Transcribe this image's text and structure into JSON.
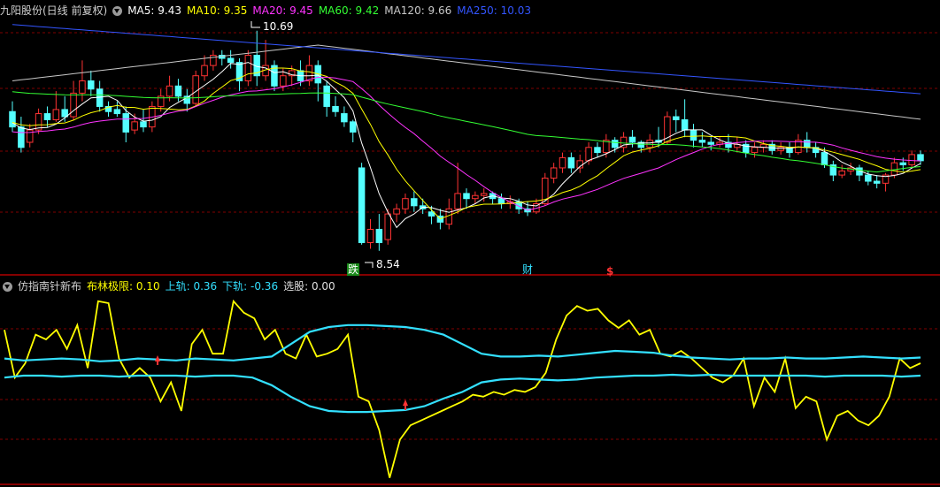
{
  "main_legend": {
    "title": "九阳股份(日线 前复权)",
    "items": [
      {
        "label": "MA5: 9.43",
        "color": "#ffffff"
      },
      {
        "label": "MA10: 9.35",
        "color": "#ffff00"
      },
      {
        "label": "MA20: 9.45",
        "color": "#ff33ff"
      },
      {
        "label": "MA60: 9.42",
        "color": "#33ff33"
      },
      {
        "label": "MA120: 9.66",
        "color": "#c8c8c8"
      },
      {
        "label": "MA250: 10.03",
        "color": "#3355ff"
      }
    ]
  },
  "indicator_legend": {
    "title": "仿指南针新布",
    "items": [
      {
        "label": "布林极限: 0.10",
        "color": "#ffff00"
      },
      {
        "label": "上轨: 0.36",
        "color": "#33e0ff"
      },
      {
        "label": "下轨: -0.36",
        "color": "#33e0ff"
      },
      {
        "label": "选股: 0.00",
        "color": "#e0e0e0"
      }
    ]
  },
  "annotations": {
    "high_price": "10.69",
    "low_price": "8.54",
    "marker_die": "跌",
    "marker_cai": "财",
    "marker_dollar": "$"
  },
  "colors": {
    "up": "#ff3333",
    "down": "#54ffff",
    "grid": "#800000",
    "separator": "#b00000"
  },
  "chart_data": [
    {
      "type": "candlestick",
      "title": "九阳股份(日线 前复权)",
      "ylim": [
        8.4,
        10.8
      ],
      "candles": [
        [
          9.9,
          9.75,
          10.0,
          9.7
        ],
        [
          9.75,
          9.55,
          9.85,
          9.5
        ],
        [
          9.6,
          9.72,
          9.78,
          9.55
        ],
        [
          9.72,
          9.88,
          9.93,
          9.68
        ],
        [
          9.88,
          9.82,
          9.95,
          9.75
        ],
        [
          9.82,
          9.92,
          10.1,
          9.8
        ],
        [
          9.92,
          9.85,
          10.05,
          9.8
        ],
        [
          9.85,
          10.08,
          10.2,
          9.82
        ],
        [
          10.08,
          10.2,
          10.4,
          10.0
        ],
        [
          10.2,
          10.12,
          10.3,
          10.05
        ],
        [
          10.12,
          9.95,
          10.2,
          9.9
        ],
        [
          9.95,
          9.9,
          10.0,
          9.85
        ],
        [
          9.92,
          9.88,
          10.0,
          9.85
        ],
        [
          9.88,
          9.7,
          9.95,
          9.6
        ],
        [
          9.72,
          9.8,
          9.88,
          9.68
        ],
        [
          9.8,
          9.75,
          9.92,
          9.7
        ],
        [
          9.75,
          9.95,
          10.0,
          9.7
        ],
        [
          9.95,
          10.05,
          10.12,
          9.9
        ],
        [
          10.05,
          10.15,
          10.25,
          10.0
        ],
        [
          10.15,
          10.05,
          10.22,
          10.0
        ],
        [
          10.05,
          9.98,
          10.12,
          9.9
        ],
        [
          9.98,
          10.25,
          10.3,
          9.95
        ],
        [
          10.25,
          10.35,
          10.45,
          10.2
        ],
        [
          10.35,
          10.45,
          10.5,
          10.3
        ],
        [
          10.45,
          10.42,
          10.5,
          10.35
        ],
        [
          10.42,
          10.38,
          10.5,
          10.32
        ],
        [
          10.38,
          10.2,
          10.42,
          10.1
        ],
        [
          10.2,
          10.45,
          10.5,
          10.15
        ],
        [
          10.45,
          10.25,
          10.69,
          10.15
        ],
        [
          10.25,
          10.35,
          10.6,
          10.2
        ],
        [
          10.35,
          10.15,
          10.4,
          10.1
        ],
        [
          10.15,
          10.25,
          10.32,
          10.1
        ],
        [
          10.25,
          10.3,
          10.35,
          10.15
        ],
        [
          10.3,
          10.2,
          10.4,
          10.15
        ],
        [
          10.2,
          10.35,
          10.45,
          10.15
        ],
        [
          10.35,
          10.18,
          10.4,
          10.0
        ],
        [
          10.15,
          9.95,
          10.2,
          9.85
        ],
        [
          9.95,
          9.9,
          10.05,
          9.85
        ],
        [
          9.88,
          9.8,
          9.95,
          9.75
        ],
        [
          9.8,
          9.7,
          9.82,
          9.6
        ],
        [
          9.35,
          8.62,
          9.4,
          8.6
        ],
        [
          8.62,
          8.75,
          8.85,
          8.56
        ],
        [
          8.75,
          8.62,
          8.9,
          8.54
        ],
        [
          8.65,
          8.9,
          8.95,
          8.6
        ],
        [
          8.9,
          8.95,
          9.0,
          8.82
        ],
        [
          8.95,
          9.05,
          9.1,
          8.9
        ],
        [
          9.05,
          8.98,
          9.12,
          8.92
        ],
        [
          8.98,
          8.95,
          9.05,
          8.9
        ],
        [
          8.92,
          8.88,
          8.98,
          8.8
        ],
        [
          8.88,
          8.82,
          8.95,
          8.75
        ],
        [
          8.8,
          8.95,
          9.05,
          8.75
        ],
        [
          8.95,
          9.1,
          9.4,
          8.9
        ],
        [
          9.1,
          9.05,
          9.15,
          8.95
        ],
        [
          9.05,
          9.08,
          9.12,
          9.0
        ],
        [
          9.08,
          9.1,
          9.15,
          9.02
        ],
        [
          9.1,
          9.05,
          9.12,
          9.0
        ],
        [
          9.05,
          9.0,
          9.1,
          8.95
        ],
        [
          9.0,
          9.02,
          9.08,
          8.95
        ],
        [
          9.02,
          8.95,
          9.05,
          8.9
        ],
        [
          8.95,
          8.92,
          9.02,
          8.88
        ],
        [
          8.92,
          9.0,
          9.05,
          8.9
        ],
        [
          9.0,
          9.25,
          9.3,
          8.98
        ],
        [
          9.25,
          9.35,
          9.4,
          9.2
        ],
        [
          9.35,
          9.45,
          9.5,
          9.3
        ],
        [
          9.45,
          9.35,
          9.5,
          9.3
        ],
        [
          9.35,
          9.42,
          9.48,
          9.3
        ],
        [
          9.42,
          9.55,
          9.6,
          9.38
        ],
        [
          9.55,
          9.5,
          9.6,
          9.45
        ],
        [
          9.5,
          9.62,
          9.68,
          9.45
        ],
        [
          9.62,
          9.55,
          9.65,
          9.5
        ],
        [
          9.55,
          9.65,
          9.7,
          9.5
        ],
        [
          9.65,
          9.6,
          9.72,
          9.55
        ],
        [
          9.6,
          9.55,
          9.62,
          9.5
        ],
        [
          9.55,
          9.62,
          9.68,
          9.5
        ],
        [
          9.62,
          9.6,
          9.75,
          9.55
        ],
        [
          9.6,
          9.85,
          9.9,
          9.58
        ],
        [
          9.85,
          9.82,
          9.92,
          9.7
        ],
        [
          9.82,
          9.72,
          10.02,
          9.65
        ],
        [
          9.72,
          9.62,
          9.78,
          9.55
        ],
        [
          9.62,
          9.6,
          9.7,
          9.55
        ],
        [
          9.6,
          9.58,
          9.65,
          9.52
        ],
        [
          9.58,
          9.6,
          9.65,
          9.55
        ],
        [
          9.6,
          9.55,
          9.68,
          9.5
        ],
        [
          9.55,
          9.58,
          9.65,
          9.5
        ],
        [
          9.58,
          9.5,
          9.62,
          9.45
        ],
        [
          9.5,
          9.55,
          9.6,
          9.45
        ],
        [
          9.55,
          9.58,
          9.62,
          9.5
        ],
        [
          9.58,
          9.52,
          9.62,
          9.48
        ],
        [
          9.52,
          9.55,
          9.6,
          9.48
        ],
        [
          9.55,
          9.5,
          9.6,
          9.45
        ],
        [
          9.5,
          9.62,
          9.68,
          9.48
        ],
        [
          9.62,
          9.55,
          9.7,
          9.5
        ],
        [
          9.55,
          9.5,
          9.6,
          9.45
        ],
        [
          9.5,
          9.38,
          9.55,
          9.35
        ],
        [
          9.38,
          9.28,
          9.42,
          9.22
        ],
        [
          9.28,
          9.32,
          9.38,
          9.25
        ],
        [
          9.32,
          9.35,
          9.4,
          9.28
        ],
        [
          9.35,
          9.28,
          9.38,
          9.22
        ],
        [
          9.28,
          9.22,
          9.32,
          9.18
        ],
        [
          9.22,
          9.2,
          9.28,
          9.15
        ],
        [
          9.2,
          9.28,
          9.3,
          9.12
        ],
        [
          9.28,
          9.4,
          9.45,
          9.25
        ],
        [
          9.4,
          9.38,
          9.45,
          9.32
        ],
        [
          9.38,
          9.48,
          9.52,
          9.35
        ],
        [
          9.48,
          9.42,
          9.52,
          9.38
        ]
      ]
    },
    {
      "type": "line",
      "title": "仿指南针新布",
      "ylim": [
        -1.0,
        1.0
      ],
      "series": [
        {
          "name": "布林极限",
          "color": "#ffff00",
          "values": [
            0.6,
            0.1,
            0.25,
            0.55,
            0.5,
            0.6,
            0.4,
            0.65,
            0.2,
            0.9,
            0.88,
            0.3,
            0.1,
            0.2,
            0.1,
            -0.15,
            0.05,
            -0.25,
            0.45,
            0.6,
            0.35,
            0.35,
            0.9,
            0.78,
            0.72,
            0.5,
            0.6,
            0.35,
            0.3,
            0.55,
            0.32,
            0.35,
            0.4,
            0.55,
            -0.1,
            -0.15,
            -0.45,
            -0.95,
            -0.55,
            -0.4,
            -0.35,
            -0.3,
            -0.25,
            -0.2,
            -0.15,
            -0.08,
            -0.1,
            -0.05,
            -0.08,
            -0.03,
            -0.05,
            0.0,
            0.15,
            0.5,
            0.75,
            0.85,
            0.8,
            0.82,
            0.7,
            0.62,
            0.7,
            0.55,
            0.6,
            0.35,
            0.32,
            0.38,
            0.3,
            0.2,
            0.1,
            0.05,
            0.12,
            0.3,
            -0.2,
            0.1,
            -0.05,
            0.3,
            -0.22,
            -0.1,
            -0.15,
            -0.55,
            -0.3,
            -0.25,
            -0.35,
            -0.4,
            -0.3,
            -0.1,
            0.3,
            0.2,
            0.25
          ]
        },
        {
          "name": "上轨",
          "color": "#33e0ff",
          "values": [
            0.3,
            0.28,
            0.29,
            0.3,
            0.29,
            0.27,
            0.28,
            0.3,
            0.29,
            0.28,
            0.3,
            0.29,
            0.28,
            0.3,
            0.32,
            0.45,
            0.58,
            0.63,
            0.65,
            0.65,
            0.64,
            0.63,
            0.6,
            0.55,
            0.45,
            0.35,
            0.32,
            0.32,
            0.33,
            0.32,
            0.34,
            0.36,
            0.38,
            0.37,
            0.36,
            0.33,
            0.31,
            0.3,
            0.29,
            0.3,
            0.3,
            0.31,
            0.3,
            0.3,
            0.31,
            0.32,
            0.31,
            0.3,
            0.31
          ]
        },
        {
          "name": "下轨",
          "color": "#33e0ff",
          "values": [
            0.1,
            0.12,
            0.12,
            0.11,
            0.12,
            0.12,
            0.11,
            0.12,
            0.12,
            0.12,
            0.11,
            0.12,
            0.12,
            0.1,
            0.02,
            -0.1,
            -0.2,
            -0.25,
            -0.26,
            -0.26,
            -0.25,
            -0.24,
            -0.2,
            -0.12,
            -0.05,
            0.05,
            0.08,
            0.09,
            0.08,
            0.07,
            0.08,
            0.1,
            0.11,
            0.12,
            0.12,
            0.13,
            0.12,
            0.13,
            0.12,
            0.12,
            0.12,
            0.12,
            0.12,
            0.11,
            0.12,
            0.12,
            0.12,
            0.11,
            0.12
          ]
        }
      ]
    }
  ]
}
